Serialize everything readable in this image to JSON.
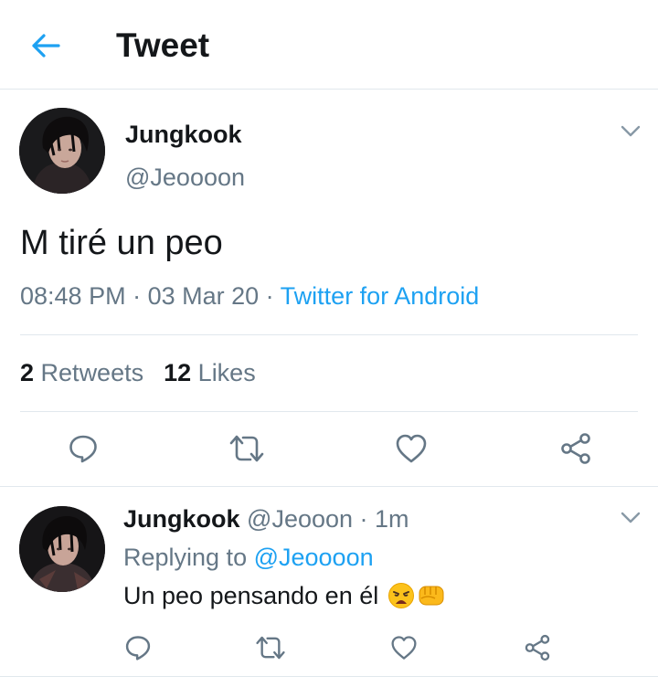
{
  "header": {
    "title": "Tweet",
    "back_icon": "arrow-left-icon",
    "accent": "#1da1f2"
  },
  "tweet": {
    "author_name": "Jungkook",
    "author_handle": "@Jeoooon",
    "text": "M tiré un peo",
    "time": "08:48 PM",
    "separator": " · ",
    "date": "03 Mar 20",
    "source": "Twitter for Android",
    "retweets_count": "2",
    "retweets_label": "Retweets",
    "likes_count": "12",
    "likes_label": "Likes",
    "actions": [
      "reply-icon",
      "retweet-icon",
      "heart-icon",
      "share-icon"
    ]
  },
  "reply": {
    "author_name": "Jungkook",
    "author_handle": "@Jeooon",
    "time_sep": " · ",
    "time": "1m",
    "replying_prefix": "Replying to ",
    "replying_to": "@Jeoooon",
    "text": "Un peo pensando en él",
    "emojis": [
      "weary-face-emoji",
      "oncoming-fist-emoji"
    ],
    "actions": [
      "reply-icon",
      "retweet-icon",
      "heart-icon",
      "share-icon"
    ]
  },
  "colors": {
    "text": "#14171a",
    "secondary": "#657786",
    "link": "#1da1f2",
    "divider": "#e1e8ed"
  }
}
